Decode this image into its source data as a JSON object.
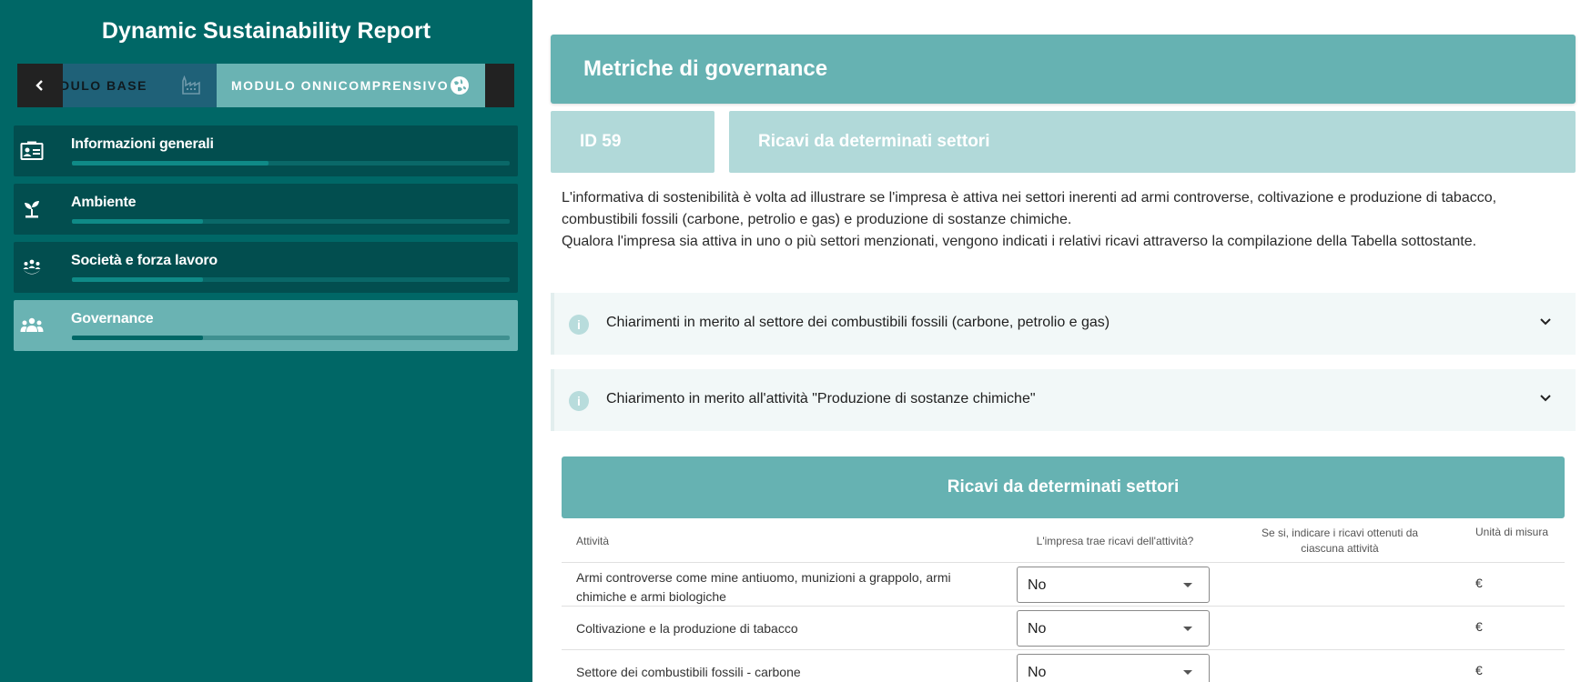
{
  "app": {
    "title": "Dynamic Sustainability Report"
  },
  "modules": {
    "back_icon": "chevron-left-icon",
    "base_label": "MODULO BASE",
    "base_visible_label": "DULO BASE",
    "base_icon": "factory-icon",
    "omni_label": "MODULO ONNICOMPRENSIVO",
    "omni_icon": "globe-icon"
  },
  "sidebar": {
    "items": [
      {
        "label": "Informazioni generali",
        "icon": "id-card-icon",
        "progress": 0.45,
        "active": false
      },
      {
        "label": "Ambiente",
        "icon": "plant-icon",
        "progress": 0.3,
        "active": false
      },
      {
        "label": "Società e forza lavoro",
        "icon": "community-icon",
        "progress": 0.3,
        "active": false
      },
      {
        "label": "Governance",
        "icon": "group-icon",
        "progress": 0.3,
        "active": true
      }
    ]
  },
  "main": {
    "section_title": "Metriche di governance",
    "metric_id": "ID 59",
    "metric_title": "Ricavi da determinati settori",
    "description": [
      "L'informativa di sostenibilità è volta ad illustrare se l'impresa è attiva nei settori inerenti ad armi controverse, coltivazione e produzione di tabacco, combustibili fossili (carbone, petrolio e gas) e produzione di sostanze chimiche.",
      "Qualora l'impresa sia attiva in uno o più settori menzionati, vengono indicati i relativi ricavi attraverso la compilazione della Tabella sottostante."
    ],
    "accordions": [
      {
        "label": "Chiarimenti in merito al settore dei combustibili fossili (carbone, petrolio e gas)",
        "icon": "info-icon"
      },
      {
        "label": "Chiarimento in merito all'attività \"Produzione di sostanze chimiche\"",
        "icon": "info-icon"
      }
    ],
    "table": {
      "title": "Ricavi da determinati settori",
      "headers": {
        "activity": "Attività",
        "revenue_question": "L'impresa trae ricavi dell'attività?",
        "revenue_amount": "Se si, indicare i ricavi ottenuti da ciascuna attività",
        "unit": "Unità di misura"
      },
      "rows": [
        {
          "activity": "Armi controverse come mine antiuomo, munizioni a grappolo, armi chimiche e armi biologiche",
          "answer": "No",
          "unit": "€"
        },
        {
          "activity": "Coltivazione e la produzione di tabacco",
          "answer": "No",
          "unit": "€"
        },
        {
          "activity": "Settore dei combustibili fossili - carbone",
          "answer": "No",
          "unit": "€"
        }
      ]
    }
  }
}
